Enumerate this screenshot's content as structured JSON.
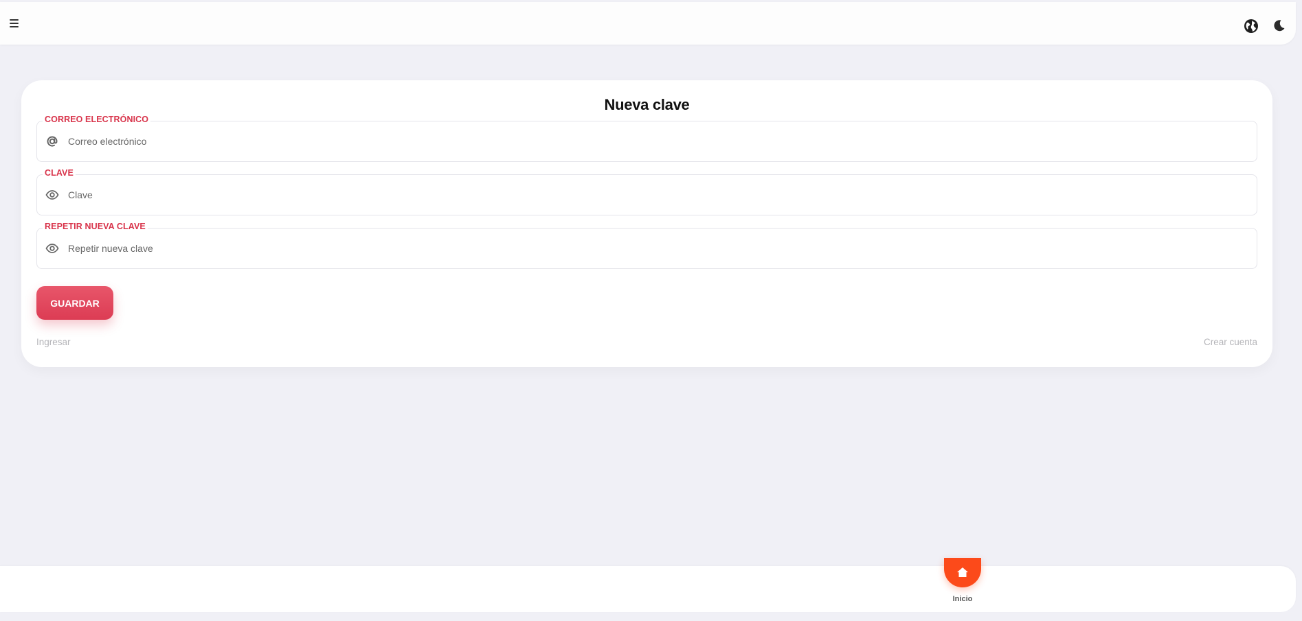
{
  "header": {
    "menu_icon": "hamburger-menu-icon",
    "language_icon": "globe-icon",
    "theme_icon": "moon-icon"
  },
  "form": {
    "title": "Nueva clave",
    "email": {
      "label": "CORREO ELECTRÓNICO",
      "placeholder": "Correo electrónico",
      "value": "",
      "icon": "at-sign-icon"
    },
    "password": {
      "label": "CLAVE",
      "placeholder": "Clave",
      "value": "",
      "icon": "eye-icon"
    },
    "repeat_password": {
      "label": "REPETIR NUEVA CLAVE",
      "placeholder": "Repetir nueva clave",
      "value": "",
      "icon": "eye-icon"
    },
    "save_label": "GUARDAR",
    "login_link": "Ingresar",
    "signup_link": "Crear cuenta"
  },
  "bottom_nav": {
    "items": [
      {
        "label": "Inicio",
        "icon": "home-icon",
        "active": true
      }
    ]
  },
  "colors": {
    "accent": "#d8334a",
    "button": "#e04a60",
    "home_active": "#fc4a1a",
    "background": "#f0f0f6"
  }
}
